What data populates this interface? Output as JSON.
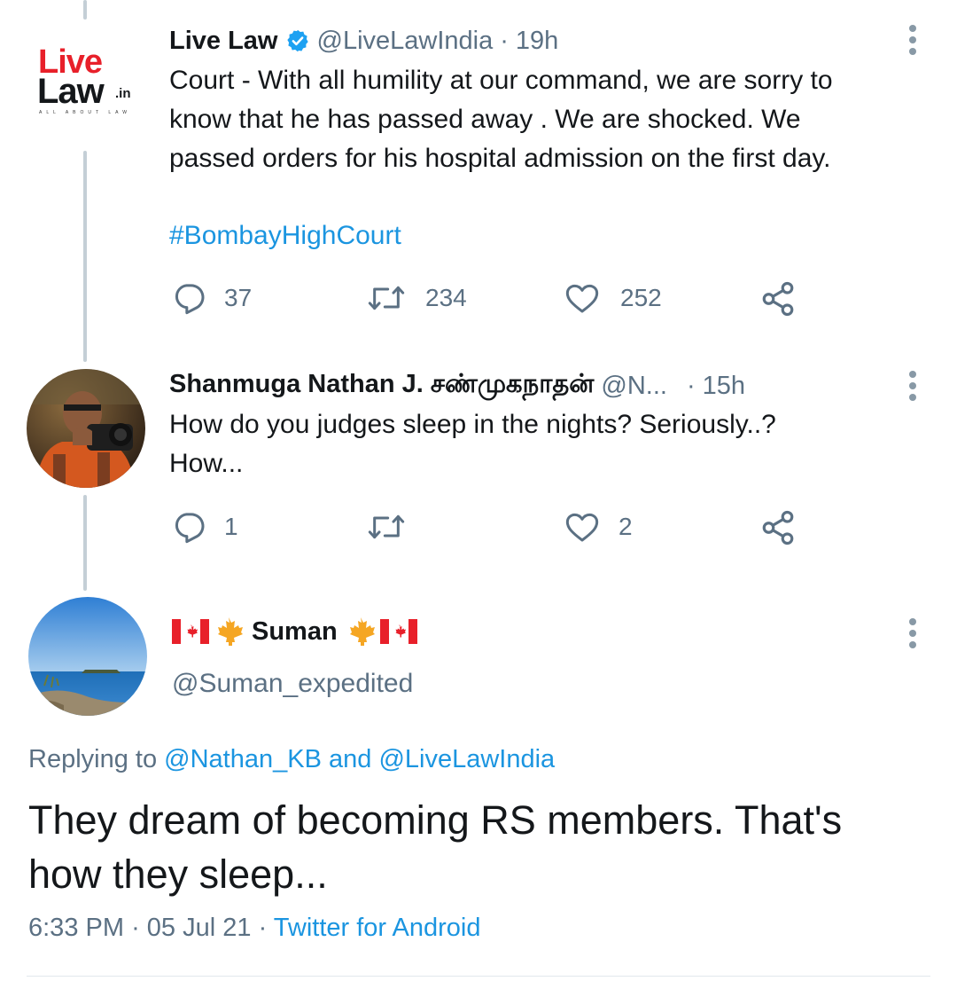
{
  "tweet1": {
    "author_name": "Live Law",
    "handle": "@LiveLawIndia",
    "separator": "·",
    "time": "19h",
    "text_lines": [
      "Court - With all humility at our command, we are sorry to",
      "know that he has passed away . We are shocked. We",
      "passed orders for his hospital admission on the first day."
    ],
    "hashtag": "#BombayHighCourt",
    "logo": {
      "line1": "Live",
      "line2": "Law",
      "suffix": ".in",
      "tagline": "ALL ABOUT LAW"
    },
    "reply_count": "37",
    "retweet_count": "234",
    "like_count": "252"
  },
  "tweet2": {
    "author_name": "Shanmuga Nathan J. சண்முகநாதன்",
    "handle": "@N...",
    "separator": "·",
    "time": "15h",
    "text_lines": [
      "How do you judges sleep in the nights? Seriously..?",
      "How..."
    ],
    "reply_count": "1",
    "like_count": "2"
  },
  "tweet3": {
    "author_name": "Suman",
    "flag_emoji": "🇨🇦",
    "leaf_emoji": "🍁",
    "handle": "@Suman_expedited",
    "replying_prefix": "Replying to",
    "replying_user1": "@Nathan_KB",
    "replying_and": "and",
    "replying_user2": "@LiveLawIndia",
    "text_lines": [
      "They dream of becoming RS members. That's",
      "how they sleep..."
    ],
    "time": "6:33 PM",
    "date": "05 Jul 21",
    "separator": "·",
    "source": "Twitter for Android"
  },
  "colors": {
    "accent": "#1b95e0",
    "verified": "#1da1f2",
    "secondary_text": "#5b7083",
    "thread_line": "#c4cfd6",
    "logo_red": "#e8202a"
  },
  "icons": [
    "reply-icon",
    "retweet-icon",
    "like-icon",
    "share-icon",
    "verified-badge-icon",
    "more-options-icon"
  ]
}
